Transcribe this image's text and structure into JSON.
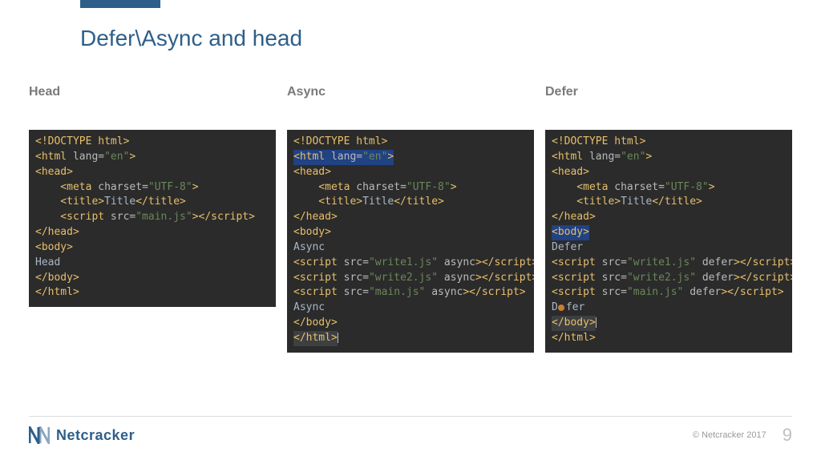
{
  "slide": {
    "title": "Defer\\Async and head",
    "page_number": "9",
    "copyright": "© Netcracker 2017",
    "brand": "Netcracker"
  },
  "columns": [
    {
      "heading": "Head"
    },
    {
      "heading": "Async"
    },
    {
      "heading": "Defer"
    }
  ],
  "code": {
    "head": {
      "l1": "<!DOCTYPE html>",
      "l2a": "<html ",
      "l2b": "lang=",
      "l2c": "\"en\"",
      "l2d": ">",
      "l3": "<head>",
      "l4a": "    <meta ",
      "l4b": "charset=",
      "l4c": "\"UTF-8\"",
      "l4d": ">",
      "l5a": "    <title>",
      "l5b": "Title",
      "l5c": "</title>",
      "l6a": "    <script ",
      "l6b": "src=",
      "l6c": "\"main.js\"",
      "l6d": "></",
      "l6e": "script>",
      "l7": "</head>",
      "l8": "<body>",
      "l9": "Head",
      "l10": "</body>",
      "l11": "</html>"
    },
    "async": {
      "l1": "<!DOCTYPE html>",
      "l2a": "<html ",
      "l2b": "lang=",
      "l2c": "\"en\"",
      "l2d": ">",
      "l3": "<head>",
      "l4a": "    <meta ",
      "l4b": "charset=",
      "l4c": "\"UTF-8\"",
      "l4d": ">",
      "l5a": "    <title>",
      "l5b": "Title",
      "l5c": "</title>",
      "l6": "</head>",
      "l7": "<body>",
      "l8": "Async",
      "l9a": "<script ",
      "l9b": "src=",
      "l9c": "\"write1.js\" ",
      "l9d": "async",
      "l9e": "></",
      "l9f": "script>",
      "l10a": "<script ",
      "l10b": "src=",
      "l10c": "\"write2.js\" ",
      "l10d": "async",
      "l10e": "></",
      "l10f": "script>",
      "l11a": "<script ",
      "l11b": "src=",
      "l11c": "\"main.js\" ",
      "l11d": "async",
      "l11e": "></",
      "l11f": "script>",
      "l12": "Async",
      "l13": "</body>",
      "l14": "</html>"
    },
    "defer": {
      "l1": "<!DOCTYPE html>",
      "l2a": "<html ",
      "l2b": "lang=",
      "l2c": "\"en\"",
      "l2d": ">",
      "l3": "<head>",
      "l4a": "    <meta ",
      "l4b": "charset=",
      "l4c": "\"UTF-8\"",
      "l4d": ">",
      "l5a": "    <title>",
      "l5b": "Title",
      "l5c": "</title>",
      "l6": "</head>",
      "l7": "<body>",
      "l8": "Defer",
      "l9a": "<script ",
      "l9b": "src=",
      "l9c": "\"write1.js\" ",
      "l9d": "defer",
      "l9e": "></",
      "l9f": "script>",
      "l10a": "<script ",
      "l10b": "src=",
      "l10c": "\"write2.js\" ",
      "l10d": "defer",
      "l10e": "></",
      "l10f": "script>",
      "l11a": "<script ",
      "l11b": "src=",
      "l11c": "\"main.js\" ",
      "l11d": "defer",
      "l11e": "></",
      "l11f": "script>",
      "l12a": "D",
      "l12b": "fer",
      "l13": "</body>",
      "l14": "</html>"
    }
  }
}
